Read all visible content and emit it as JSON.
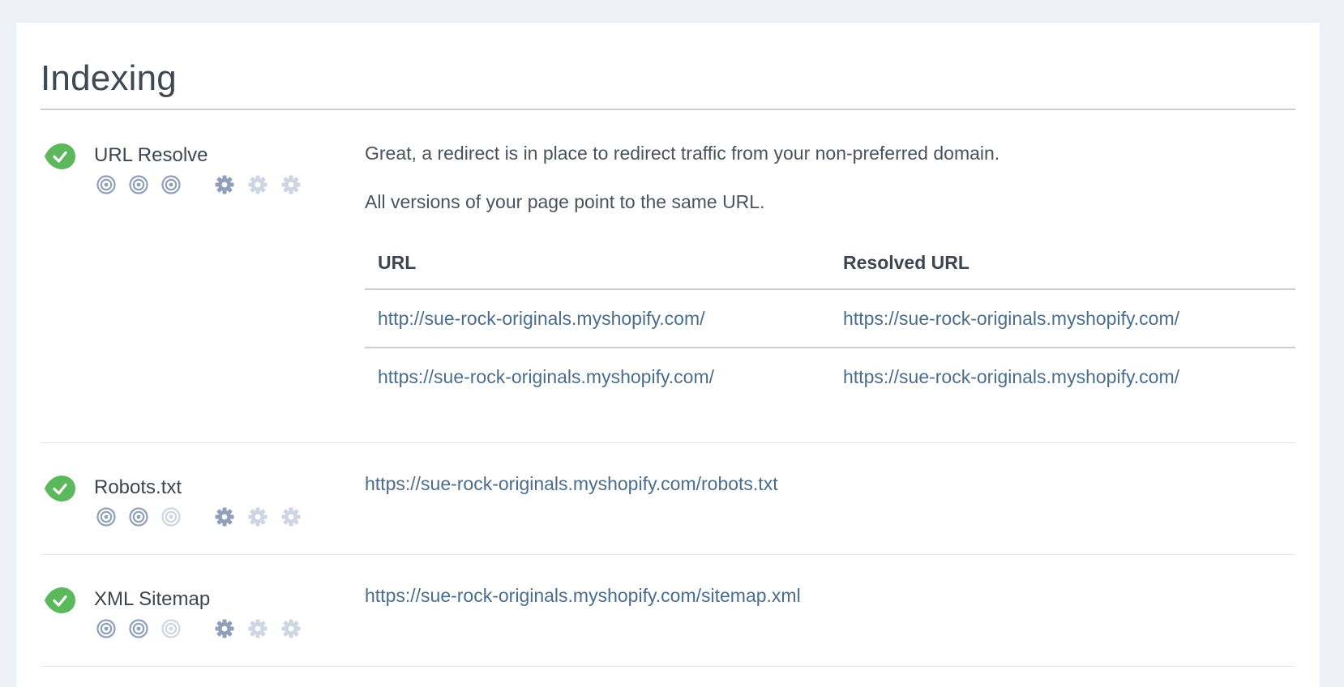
{
  "section": {
    "title": "Indexing"
  },
  "colors": {
    "success": "#5cb85c",
    "link": "#4a6d8e",
    "icon_active": "#8fa0b8",
    "icon_inactive": "#cdd6e2"
  },
  "checks": [
    {
      "name": "URL Resolve",
      "status": "pass",
      "status_icon": "check-badge-icon",
      "importance_icons": [
        "target-icon",
        "target-icon",
        "target-icon"
      ],
      "importance_level": 3,
      "difficulty_icons": [
        "gear-icon",
        "gear-icon",
        "gear-icon"
      ],
      "difficulty_level": 1,
      "messages": [
        "Great, a redirect is in place to redirect traffic from your non-preferred domain.",
        "All versions of your page point to the same URL."
      ],
      "table": {
        "headers": [
          "URL",
          "Resolved URL"
        ],
        "rows": [
          [
            "http://sue-rock-originals.myshopify.com/",
            "https://sue-rock-originals.myshopify.com/"
          ],
          [
            "https://sue-rock-originals.myshopify.com/",
            "https://sue-rock-originals.myshopify.com/"
          ]
        ]
      }
    },
    {
      "name": "Robots.txt",
      "status": "pass",
      "status_icon": "check-badge-icon",
      "importance_icons": [
        "target-icon",
        "target-icon",
        "target-icon"
      ],
      "importance_level": 2,
      "difficulty_icons": [
        "gear-icon",
        "gear-icon",
        "gear-icon"
      ],
      "difficulty_level": 1,
      "link": "https://sue-rock-originals.myshopify.com/robots.txt"
    },
    {
      "name": "XML Sitemap",
      "status": "pass",
      "status_icon": "check-badge-icon",
      "importance_icons": [
        "target-icon",
        "target-icon",
        "target-icon"
      ],
      "importance_level": 2,
      "difficulty_icons": [
        "gear-icon",
        "gear-icon",
        "gear-icon"
      ],
      "difficulty_level": 1,
      "link": "https://sue-rock-originals.myshopify.com/sitemap.xml"
    }
  ]
}
